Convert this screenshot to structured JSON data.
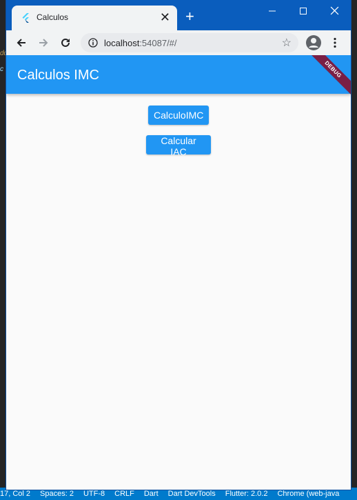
{
  "editor_bg": {
    "fragment_1": "dd",
    "fragment_2": "c",
    "status_items": [
      "17, Col 2",
      "Spaces: 2",
      "UTF-8",
      "CRLF",
      "Dart",
      "Dart DevTools",
      "Flutter: 2.0.2",
      "Chrome (web-java"
    ]
  },
  "browser": {
    "tab_title": "Calculos",
    "url_host": "localhost",
    "url_rest": ":54087/#/",
    "new_tab": "+",
    "tab_close": "✕"
  },
  "app": {
    "title": "Calculos IMC",
    "debug_banner": "DEBUG",
    "buttons": {
      "imc": "CalculoIMC",
      "iac": "Calcular IAC"
    },
    "colors": {
      "primary": "#2196f3",
      "background": "#fafafa",
      "banner": "#7a1f45"
    }
  }
}
